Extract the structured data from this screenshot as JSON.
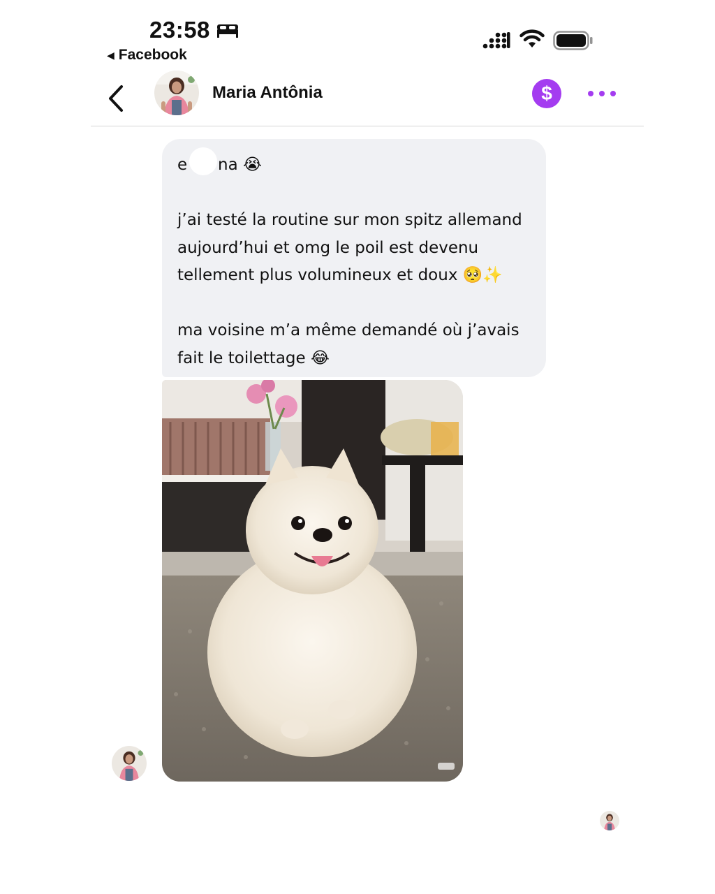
{
  "status_bar": {
    "time": "23:58",
    "sleep_icon": "bed-icon",
    "back_app_label": "Facebook",
    "icons": [
      "signal-icon",
      "wifi-icon",
      "battery-icon"
    ]
  },
  "header": {
    "contact_name": "Maria Antônia",
    "pay_symbol": "$",
    "accent_color": "#a43cf0"
  },
  "message": {
    "lines": [
      "e      na 😭",
      "",
      "j’ai testé la routine sur mon spitz allemand",
      "aujourd’hui et omg le poil est devenu",
      "tellement plus volumineux et doux 🥺✨",
      "",
      "ma voisine m’a même demandé où j’avais",
      "fait le toilettage 😂"
    ],
    "bubble_color": "#f0f1f4"
  },
  "attachment": {
    "type": "photo",
    "subject": "pomeranian-dog"
  }
}
